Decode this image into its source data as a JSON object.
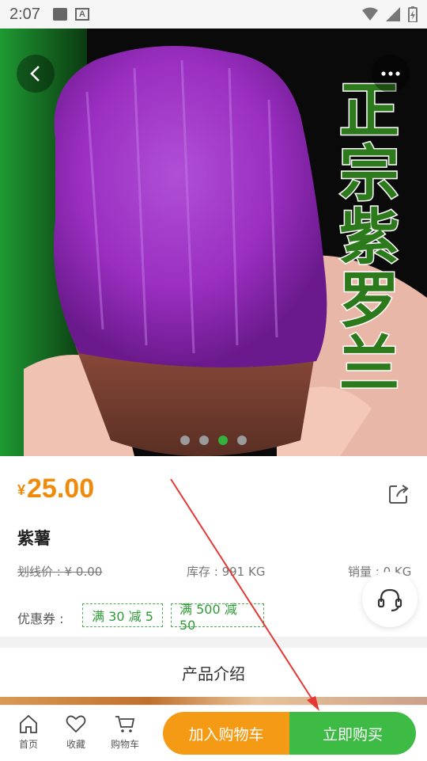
{
  "status_bar": {
    "time": "2:07"
  },
  "hero": {
    "title_chars": [
      "正",
      "宗",
      "紫",
      "罗",
      "兰"
    ],
    "carousel_count": 4,
    "carousel_active_index": 2
  },
  "product": {
    "currency": "¥",
    "price": "25.00",
    "name": "紫薯",
    "original_price_label": "划线价 : ¥ 0.00",
    "stock_label": "库存 : 991 KG",
    "sales_label": "销量 : 0 KG",
    "coupon_label": "优惠券 :",
    "coupons": [
      "满 30 减 5",
      "满 500 减 50"
    ]
  },
  "intro_title": "产品介绍",
  "bottom_nav": {
    "home": "首页",
    "favorite": "收藏",
    "cart": "购物车",
    "add_to_cart": "加入购物车",
    "buy_now": "立即购买"
  },
  "colors": {
    "price": "#f08a0a",
    "accent_green": "#3dbb44",
    "accent_orange": "#f59a14",
    "annotation_red": "#e53935"
  }
}
